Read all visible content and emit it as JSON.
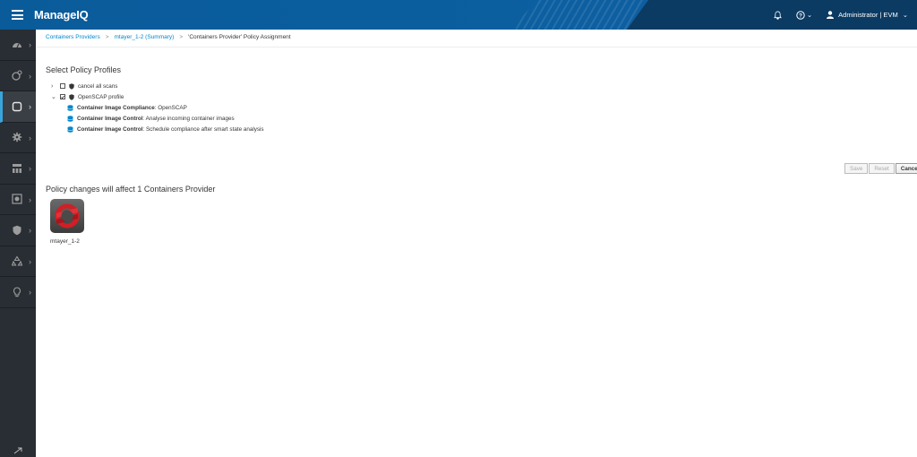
{
  "app": {
    "brand": "ManageIQ"
  },
  "header": {
    "notifications_icon": "bell-icon",
    "help_icon": "question-circle-icon",
    "help_caret": "⌄",
    "user_label": "Administrator | EVM",
    "user_caret": "⌄"
  },
  "sidebar": {
    "items": [
      {
        "icon": "dashboard-icon"
      },
      {
        "icon": "compute-icon"
      },
      {
        "icon": "containers-icon",
        "active": true
      },
      {
        "icon": "settings-gear-icon"
      },
      {
        "icon": "network-icon"
      },
      {
        "icon": "storage-icon"
      },
      {
        "icon": "shield-icon"
      },
      {
        "icon": "automation-icon"
      },
      {
        "icon": "optimize-icon"
      }
    ],
    "chevron": "›"
  },
  "breadcrumb": {
    "items": [
      "Containers Providers",
      "mtayer_1-2 (Summary)",
      "'Containers Provider' Policy Assignment"
    ],
    "separator": ">"
  },
  "select_title": "Select Policy Profiles",
  "tree": {
    "profiles": [
      {
        "label": "cancel all scans",
        "checked": false,
        "expanded": false,
        "toggle": "›"
      },
      {
        "label": "OpenSCAP profile",
        "checked": true,
        "expanded": true,
        "toggle": "⌄"
      }
    ],
    "policies": [
      {
        "bold": "Container Image Compliance",
        "rest": ": OpenSCAP"
      },
      {
        "bold": "Container Image Control",
        "rest": ": Analyse incoming container images"
      },
      {
        "bold": "Container Image Control",
        "rest": ": Schedule compliance after smart state analysis"
      }
    ]
  },
  "buttons": {
    "save": "Save",
    "reset": "Reset",
    "cancel": "Cancel"
  },
  "affect_title": "Policy changes will affect 1 Containers Provider",
  "provider": {
    "name": "mtayer_1-2",
    "icon": "openshift-icon"
  },
  "colors": {
    "link": "#0088ce",
    "header": "#0b5f9f",
    "sidebar": "#292e34",
    "accent": "#39a5dc"
  }
}
